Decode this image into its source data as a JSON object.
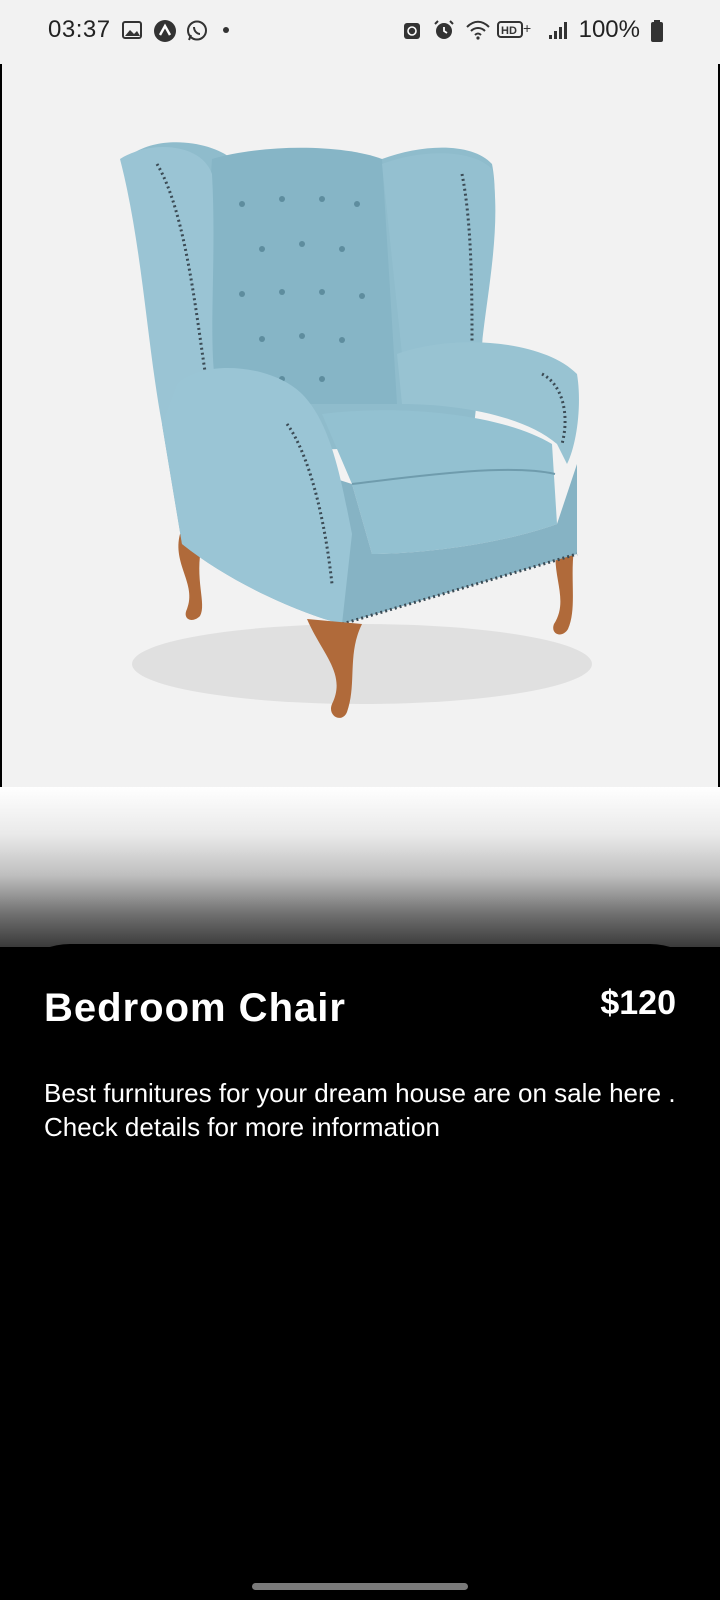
{
  "status_bar": {
    "time": "03:37",
    "battery": "100%",
    "left_icons": [
      "gallery-icon",
      "app-a-icon",
      "whatsapp-icon",
      "dot-icon"
    ],
    "right_icons": [
      "lock-rotate-icon",
      "alarm-icon",
      "wifi-icon",
      "hd-plus-icon",
      "signal-icon",
      "battery-icon"
    ]
  },
  "product": {
    "image": "blue-wingback-chair",
    "title": "Bedroom Chair",
    "price": "$120",
    "description": "Best furnitures for your dream house are on sale here . Check details for more information"
  },
  "colors": {
    "panel": "#000000",
    "image_bg": "#f2f2f2",
    "chair_fabric": "#8fbccc",
    "chair_legs": "#b06a3a"
  }
}
